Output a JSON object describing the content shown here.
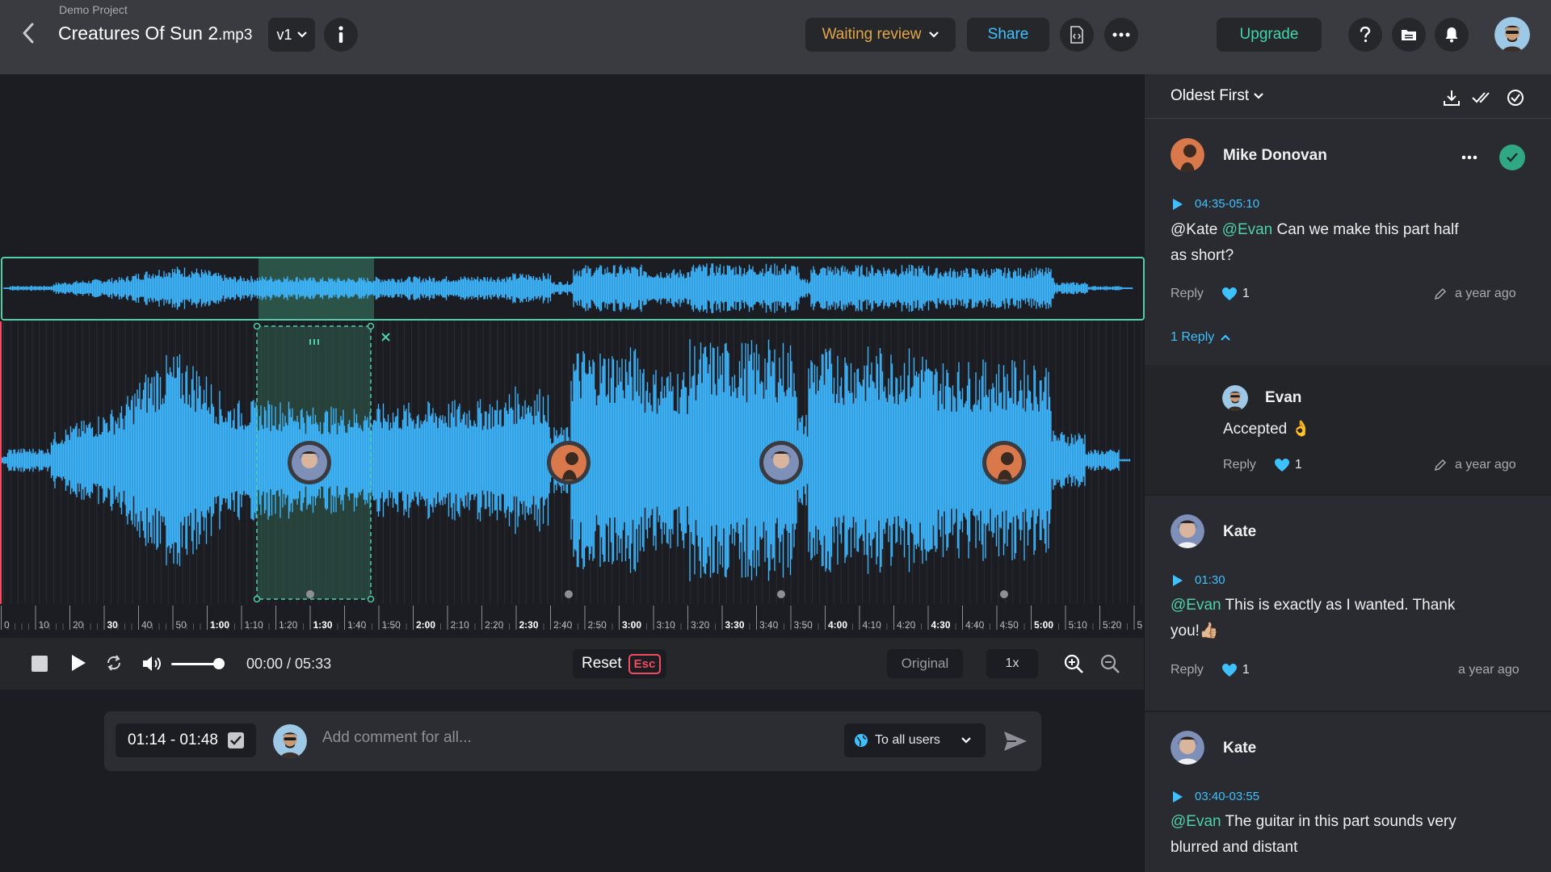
{
  "header": {
    "project": "Demo Project",
    "title": "Creatures Of Sun 2",
    "title_ext": ".mp3",
    "version": "v1",
    "status": "Waiting review",
    "share": "Share",
    "upgrade": "Upgrade"
  },
  "colors": {
    "accent_green": "#4fd0a9",
    "accent_blue": "#3ec1ff",
    "waveform": "#3db7ff",
    "status_orange": "#e2a548",
    "esc_red": "#ef4d5f"
  },
  "player": {
    "time": "00:00 / 05:33",
    "reset": "Reset",
    "esc": "Esc",
    "original": "Original",
    "speed": "1x",
    "ruler": [
      "0",
      "10",
      "20",
      "30",
      "40",
      "50",
      "1:00",
      "1:10",
      "1:20",
      "1:30",
      "1:40",
      "1:50",
      "2:00",
      "2:10",
      "2:20",
      "2:30",
      "2:40",
      "2:50",
      "3:00",
      "3:10",
      "3:20",
      "3:30",
      "3:40",
      "3:50",
      "4:00",
      "4:10",
      "4:20",
      "4:30",
      "4:40",
      "4:50",
      "5:00",
      "5:10",
      "5:20",
      "5"
    ]
  },
  "composer": {
    "range": "01:14 - 01:48",
    "placeholder": "Add comment for all...",
    "audience": "To all users"
  },
  "panel": {
    "sort": "Oldest First",
    "comments": [
      {
        "author": "Mike Donovan",
        "timestamp": "04:35-05:10",
        "mention1": "@Kate",
        "mention2": "@Evan",
        "text_line1": " Can we make this part half",
        "text_line2": "as short?",
        "reply_label": "Reply",
        "likes": "1",
        "ago": "a year ago",
        "replies_toggle": "1 Reply",
        "reply": {
          "author": "Evan",
          "text": "Accepted 👌",
          "reply_label": "Reply",
          "likes": "1",
          "ago": "a year ago"
        }
      },
      {
        "author": "Kate",
        "timestamp": "01:30",
        "mention": "@Evan",
        "text_line1": " This is exactly as I wanted. Thank",
        "text_line2": "you!👍🏼",
        "reply_label": "Reply",
        "likes": "1",
        "ago": "a year ago"
      },
      {
        "author": "Kate",
        "timestamp": "03:40-03:55",
        "mention": "@Evan",
        "text_line1": " The guitar in this part sounds very",
        "text_line2": "blurred and distant"
      }
    ]
  }
}
